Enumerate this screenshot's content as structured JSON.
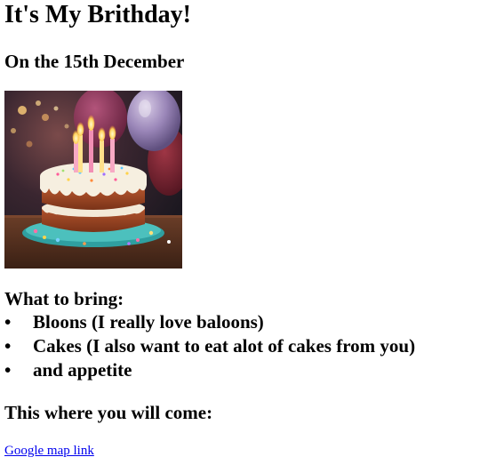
{
  "page": {
    "title": "It's My Brithday!",
    "subtitle": "On the 15th December"
  },
  "image": {
    "subject": "birthday cake with lit candles and balloons"
  },
  "bring": {
    "heading": "What to bring:",
    "items": [
      "Bloons (I really love baloons)",
      "Cakes (I also want to eat alot of cakes from you)",
      "and appetite"
    ]
  },
  "location": {
    "heading": "This where you will come:",
    "link_text": "Google map link"
  },
  "colors": {
    "link": "#0000ee",
    "text": "#000000",
    "background": "#ffffff"
  }
}
